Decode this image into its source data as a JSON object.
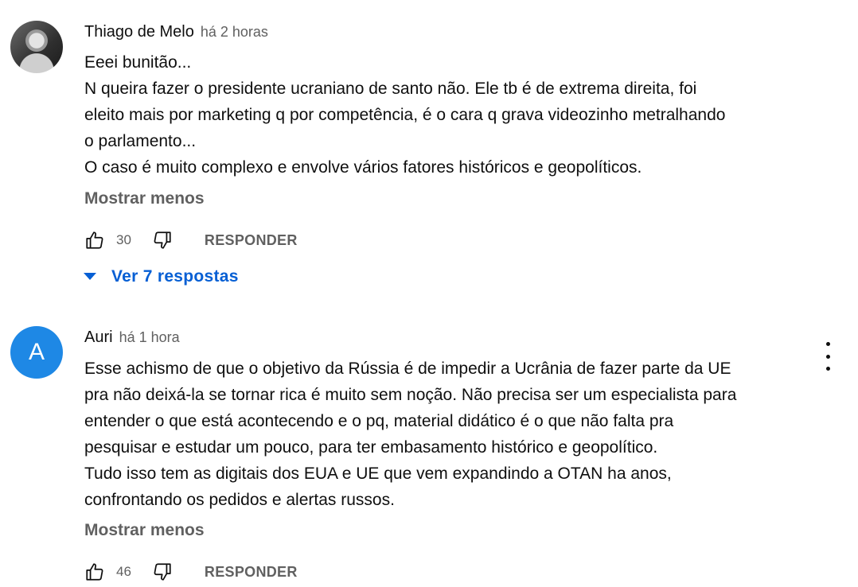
{
  "comments": [
    {
      "author": "Thiago de Melo",
      "time": "há 2 horas",
      "lines": [
        "Eeei bunitão...",
        "N queira fazer o presidente ucraniano de santo não. Ele tb é de extrema direita, foi",
        "eleito mais por marketing q por competência, é o cara q grava videozinho metralhando",
        "o parlamento...",
        "O caso é muito complexo e envolve vários fatores históricos e geopolíticos."
      ],
      "show_less": "Mostrar menos",
      "likes": "30",
      "reply_label": "RESPONDER",
      "replies_label": "Ver 7 respostas"
    },
    {
      "author": "Auri",
      "time": "há 1 hora",
      "avatar_letter": "A",
      "lines": [
        "Esse achismo de que o objetivo da Rússia é de impedir a Ucrânia de fazer parte da UE",
        "pra não deixá-la se tornar rica é muito sem noção. Não precisa ser um especialista para",
        "entender o que está acontecendo e o pq, material didático é o que não falta pra",
        "pesquisar e estudar um pouco, para ter embasamento histórico e geopolítico.",
        "Tudo isso tem as digitais dos EUA e UE que vem expandindo a OTAN ha anos,",
        "confrontando os pedidos e alertas russos."
      ],
      "show_less": "Mostrar menos",
      "likes": "46",
      "reply_label": "RESPONDER"
    }
  ],
  "colors": {
    "link_blue": "#065fd4",
    "avatar_blue": "#1e88e5",
    "muted": "#606060"
  }
}
